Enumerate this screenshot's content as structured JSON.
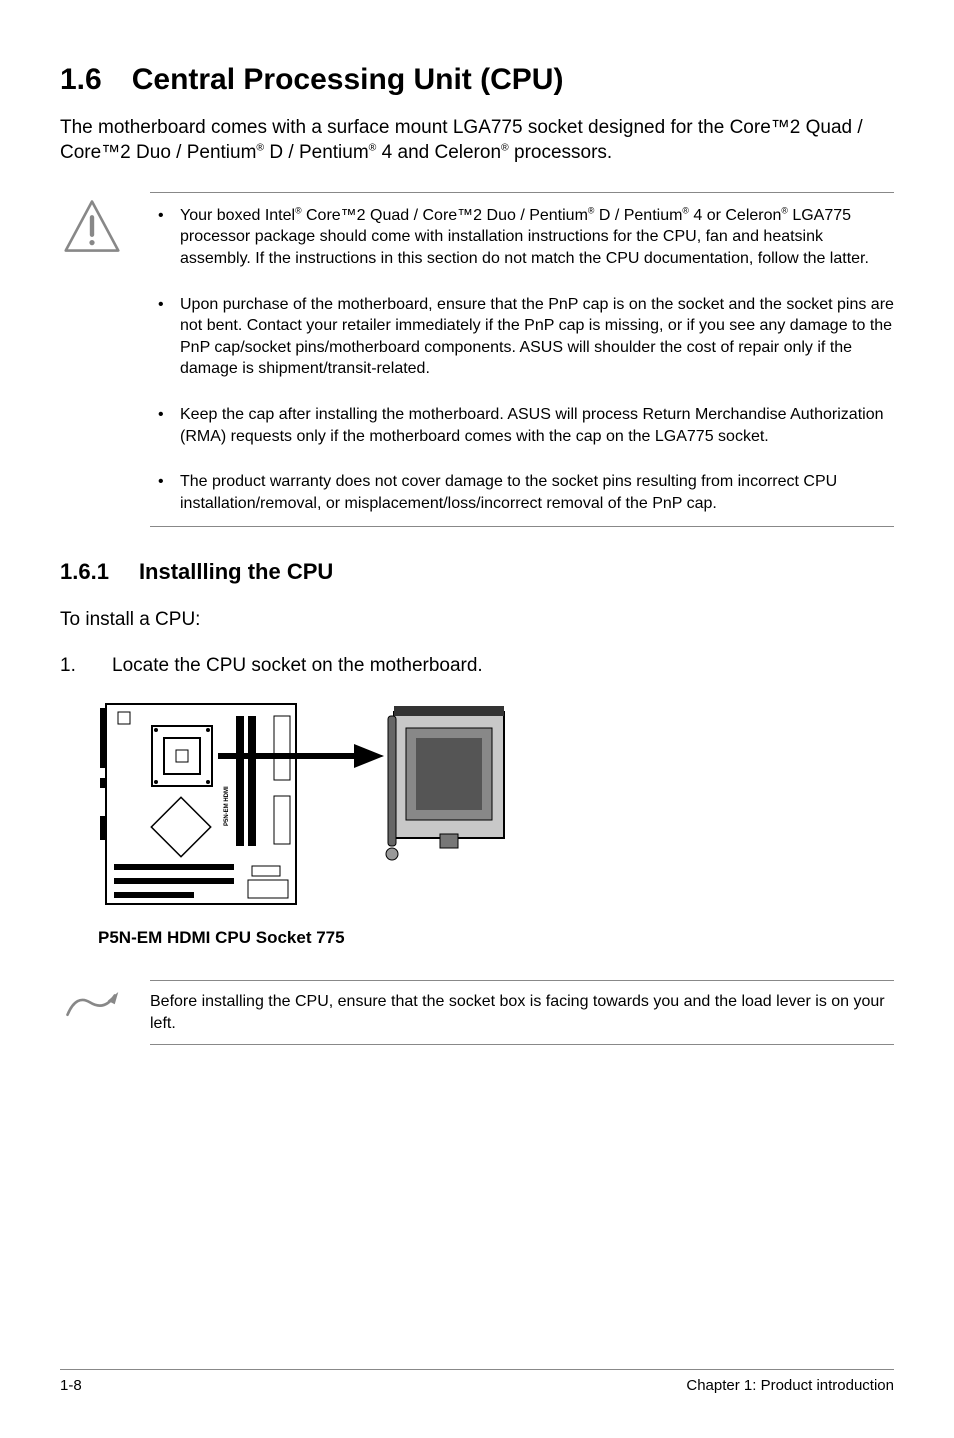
{
  "heading": {
    "num": "1.6",
    "title": "Central Processing Unit (CPU)"
  },
  "intro_parts": {
    "a": "The motherboard comes with a surface mount LGA775 socket designed for the Core™2 Quad / Core™2 Duo / Pentium",
    "b": " D / Pentium",
    "c": " 4 and Celeron",
    "d": " processors."
  },
  "warning_items": [
    {
      "p1": "Your boxed Intel",
      "p2": " Core™2 Quad / Core™2 Duo / Pentium",
      "p3": " D / Pentium",
      "p4": " 4 or Celeron",
      "p5": " LGA775 processor package should come with installation instructions for the CPU, fan and heatsink assembly. If the instructions in this section do not match the CPU documentation, follow the latter."
    },
    {
      "p1": "Upon purchase of the motherboard, ensure that the PnP cap is on the socket and the socket pins are not bent. Contact your retailer immediately if the PnP cap is missing, or if you see any damage to the PnP cap/socket pins/motherboard components. ASUS will shoulder the cost of repair only if the damage is shipment/transit-related."
    },
    {
      "p1": "Keep the cap after installing the motherboard. ASUS will process Return Merchandise Authorization (RMA) requests only if the motherboard comes with the cap on the LGA775 socket."
    },
    {
      "p1": "The product warranty does not cover damage to the socket pins resulting from incorrect CPU installation/removal, or misplacement/loss/incorrect removal of the PnP cap."
    }
  ],
  "subheading": {
    "num": "1.6.1",
    "title": "Installling the CPU"
  },
  "install_intro": "To install a CPU:",
  "step1": {
    "num": "1.",
    "text": "Locate the CPU socket on the motherboard."
  },
  "diagram": {
    "board_label": "P5N-EM HDMI",
    "caption": "P5N-EM HDMI CPU Socket 775"
  },
  "tip_text": "Before installing the CPU, ensure that the socket box is facing towards you and the load lever is on your left.",
  "reg_mark": "®",
  "footer": {
    "left": "1-8",
    "right": "Chapter 1: Product introduction"
  },
  "icons": {
    "warning": "warning-triangle-icon",
    "tip": "pencil-note-icon"
  }
}
